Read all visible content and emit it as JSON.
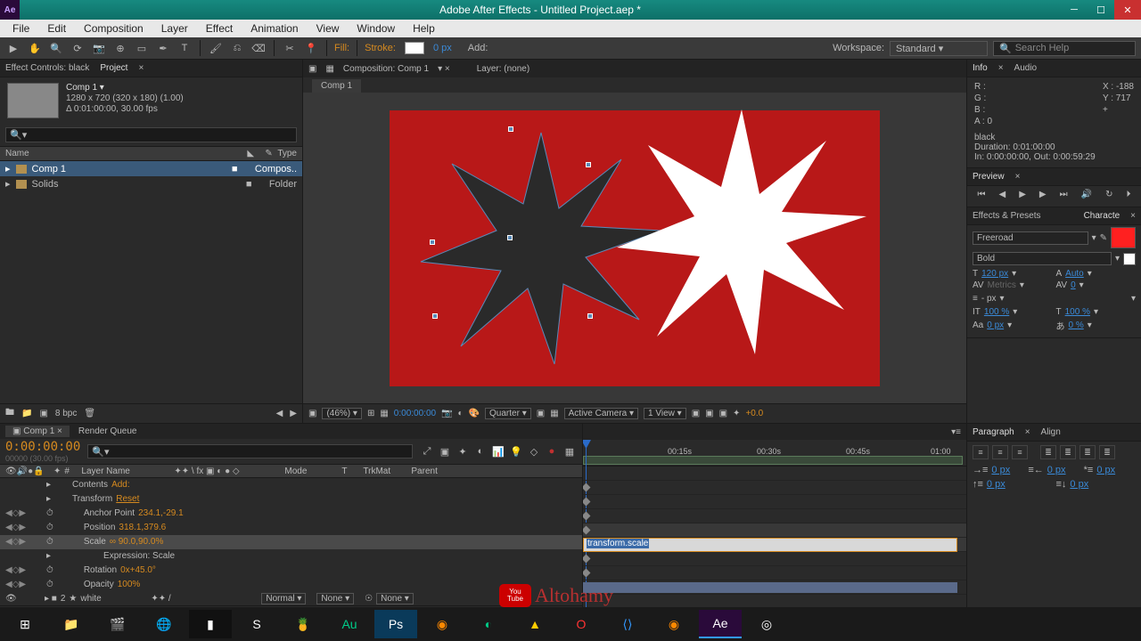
{
  "titlebar": {
    "title": "Adobe After Effects - Untitled Project.aep *",
    "app_abbr": "Ae"
  },
  "menu": [
    "File",
    "Edit",
    "Composition",
    "Layer",
    "Effect",
    "Animation",
    "View",
    "Window",
    "Help"
  ],
  "toolbar": {
    "fill_label": "Fill:",
    "stroke_label": "Stroke:",
    "stroke_px": "0 px",
    "add_label": "Add:",
    "workspace_label": "Workspace:",
    "workspace_value": "Standard",
    "search_placeholder": "Search Help"
  },
  "project_panel": {
    "tabs": [
      "Effect Controls: black",
      "Project"
    ],
    "comp_name": "Comp 1 ▾",
    "comp_res": "1280 x 720  (320 x 180) (1.00)",
    "comp_dur": "Δ 0:01:00:00, 30.00 fps",
    "cols": {
      "name": "Name",
      "type": "Type"
    },
    "items": [
      {
        "name": "Comp 1",
        "type": "Compos..",
        "sel": true
      },
      {
        "name": "Solids",
        "type": "Folder",
        "sel": false
      }
    ],
    "bpc": "8 bpc"
  },
  "comp_panel": {
    "tabs_prefix": "Composition: Comp 1",
    "layer_tab": "Layer: (none)",
    "mini_tab": "Comp 1",
    "zoom": "(46%)",
    "timecode": "0:00:00:00",
    "quality": "Quarter",
    "camera": "Active Camera",
    "views": "1 View",
    "exposure": "+0.0"
  },
  "info_panel": {
    "tabs": [
      "Info",
      "Audio"
    ],
    "r": "R :",
    "g": "G :",
    "b": "B :",
    "a": "A :  0",
    "x": "X : -188",
    "y": "Y :  717",
    "layer_name": "black",
    "duration": "Duration: 0:01:00:00",
    "inout": "In: 0:00:00:00, Out: 0:00:59:29"
  },
  "preview_panel": {
    "tab": "Preview",
    "close": "×"
  },
  "effects_panel": {
    "tabs": [
      "Effects & Presets",
      "Characte"
    ]
  },
  "character": {
    "font": "Freeroad",
    "weight": "Bold",
    "size": "120 px",
    "leading": "Auto",
    "kerning": "Metrics",
    "tracking": "0",
    "stroke": "- px",
    "vscale": "100 %",
    "hscale": "100 %",
    "baseline": "0 px",
    "tsume": "0 %"
  },
  "paragraph": {
    "tabs": [
      "Paragraph",
      "Align"
    ],
    "indent_l": "0 px",
    "indent_r": "0 px",
    "first": "0 px",
    "space_before": "0 px",
    "space_after": "0 px"
  },
  "timeline": {
    "tabs": [
      "Comp 1",
      "Render Queue"
    ],
    "timecode": "0:00:00:00",
    "frame": "00000 (30.00 fps)",
    "cols": {
      "num": "#",
      "layer": "Layer Name",
      "mode": "Mode",
      "t": "T",
      "trkmat": "TrkMat",
      "parent": "Parent"
    },
    "ruler": [
      "00:15s",
      "00:30s",
      "00:45s",
      "01:00"
    ],
    "rows": [
      {
        "label": "Contents",
        "val": "Add:",
        "indent": 50
      },
      {
        "label": "Transform",
        "val": "Reset",
        "indent": 50,
        "val_link": true
      },
      {
        "label": "Anchor Point",
        "val": "234.1,-29.1",
        "kf": true,
        "indent": 60
      },
      {
        "label": "Position",
        "val": "318.1,379.6",
        "kf": true,
        "indent": 60
      },
      {
        "label": "Scale",
        "val": "∞ 90.0,90.0%",
        "kf": true,
        "indent": 60,
        "sel": true
      },
      {
        "label": "Expression: Scale",
        "val": "",
        "indent": 85
      },
      {
        "label": "Rotation",
        "val": "0x+45.0°",
        "kf": true,
        "indent": 60
      },
      {
        "label": "Opacity",
        "val": "100%",
        "kf": true,
        "indent": 60
      }
    ],
    "layer2": {
      "num": "2",
      "name": "white",
      "mode": "Normal",
      "trkmat": "None",
      "parent": "None"
    },
    "expression": "transform.scale"
  },
  "watermark": "Altohamy"
}
